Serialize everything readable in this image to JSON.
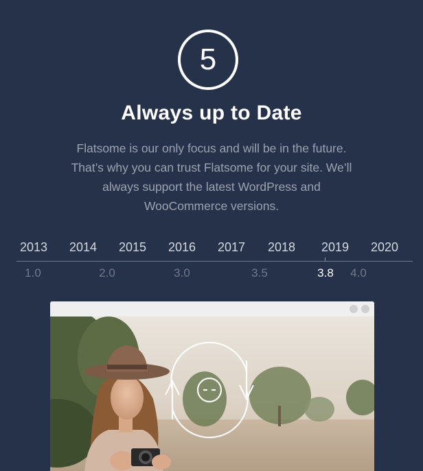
{
  "step": {
    "number": "5"
  },
  "title": "Always up to Date",
  "description": [
    "Flatsome is our only focus and will be in the future.",
    "That’s why you can trust Flatsome for your site. We’ll",
    "always support the latest WordPress and",
    "WooCommerce versions."
  ],
  "timeline": {
    "years": [
      "2013",
      "2014",
      "2015",
      "2016",
      "2017",
      "2018",
      "2019",
      "2020"
    ],
    "versions": [
      "1.0",
      "2.0",
      "3.0",
      "3.5",
      "3.8",
      "4.0"
    ],
    "current_version": "3.8"
  },
  "colors": {
    "background": "#26324a",
    "text_muted": "#9aa3b2",
    "timeline_line": "#6f7a8c"
  },
  "icons": {
    "update": "refresh-arrows-icon"
  }
}
